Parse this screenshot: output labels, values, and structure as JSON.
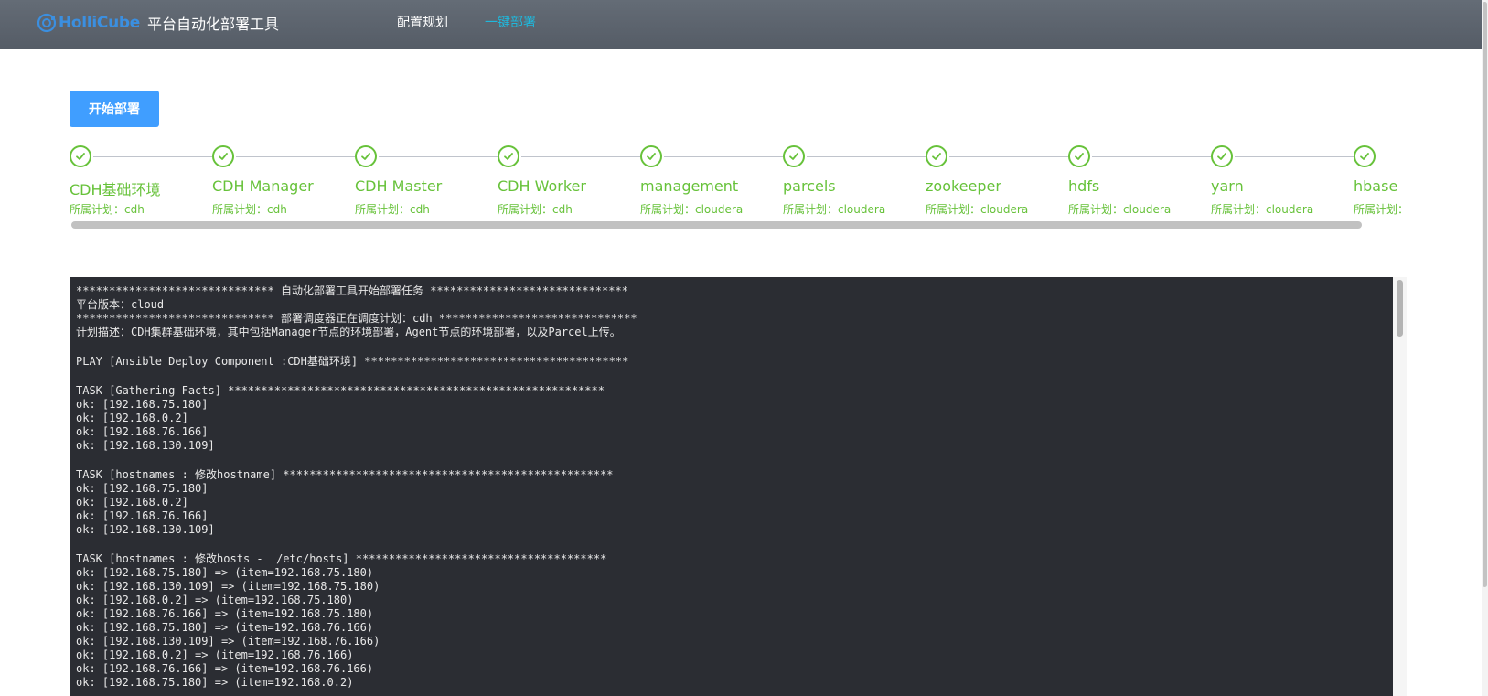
{
  "header": {
    "logo_text": "HolliCube",
    "app_title": "平台自动化部署工具",
    "nav": [
      {
        "label": "配置规划",
        "active": false
      },
      {
        "label": "一键部署",
        "active": true
      }
    ],
    "accent_color": "#1fb8dc",
    "logo_color": "#3b8fe0"
  },
  "actions": {
    "start_label": "开始部署",
    "button_color": "#409eff"
  },
  "steps": {
    "status_color": "#67c23a",
    "status_icon": "check-circle-icon",
    "items": [
      {
        "title": "CDH基础环境",
        "desc": "所属计划：cdh"
      },
      {
        "title": "CDH Manager",
        "desc": "所属计划：cdh"
      },
      {
        "title": "CDH Master",
        "desc": "所属计划：cdh"
      },
      {
        "title": "CDH Worker",
        "desc": "所属计划：cdh"
      },
      {
        "title": "management",
        "desc": "所属计划：cloudera"
      },
      {
        "title": "parcels",
        "desc": "所属计划：cloudera"
      },
      {
        "title": "zookeeper",
        "desc": "所属计划：cloudera"
      },
      {
        "title": "hdfs",
        "desc": "所属计划：cloudera"
      },
      {
        "title": "yarn",
        "desc": "所属计划：cloudera"
      },
      {
        "title": "hbase",
        "desc": "所属计划："
      }
    ]
  },
  "log": {
    "lines": [
      "****************************** 自动化部署工具开始部署任务 ******************************",
      "平台版本：cloud",
      "****************************** 部署调度器正在调度计划：cdh ******************************",
      "计划描述：CDH集群基础环境，其中包括Manager节点的环境部署，Agent节点的环境部署，以及Parcel上传。",
      "",
      "PLAY [Ansible Deploy Component :CDH基础环境] ****************************************",
      "",
      "TASK [Gathering Facts] *********************************************************",
      "ok: [192.168.75.180]",
      "ok: [192.168.0.2]",
      "ok: [192.168.76.166]",
      "ok: [192.168.130.109]",
      "",
      "TASK [hostnames : 修改hostname] **************************************************",
      "ok: [192.168.75.180]",
      "ok: [192.168.0.2]",
      "ok: [192.168.76.166]",
      "ok: [192.168.130.109]",
      "",
      "TASK [hostnames : 修改hosts -  /etc/hosts] **************************************",
      "ok: [192.168.75.180] => (item=192.168.75.180)",
      "ok: [192.168.130.109] => (item=192.168.75.180)",
      "ok: [192.168.0.2] => (item=192.168.75.180)",
      "ok: [192.168.76.166] => (item=192.168.75.180)",
      "ok: [192.168.75.180] => (item=192.168.76.166)",
      "ok: [192.168.130.109] => (item=192.168.76.166)",
      "ok: [192.168.0.2] => (item=192.168.76.166)",
      "ok: [192.168.76.166] => (item=192.168.76.166)",
      "ok: [192.168.75.180] => (item=192.168.0.2)"
    ]
  }
}
